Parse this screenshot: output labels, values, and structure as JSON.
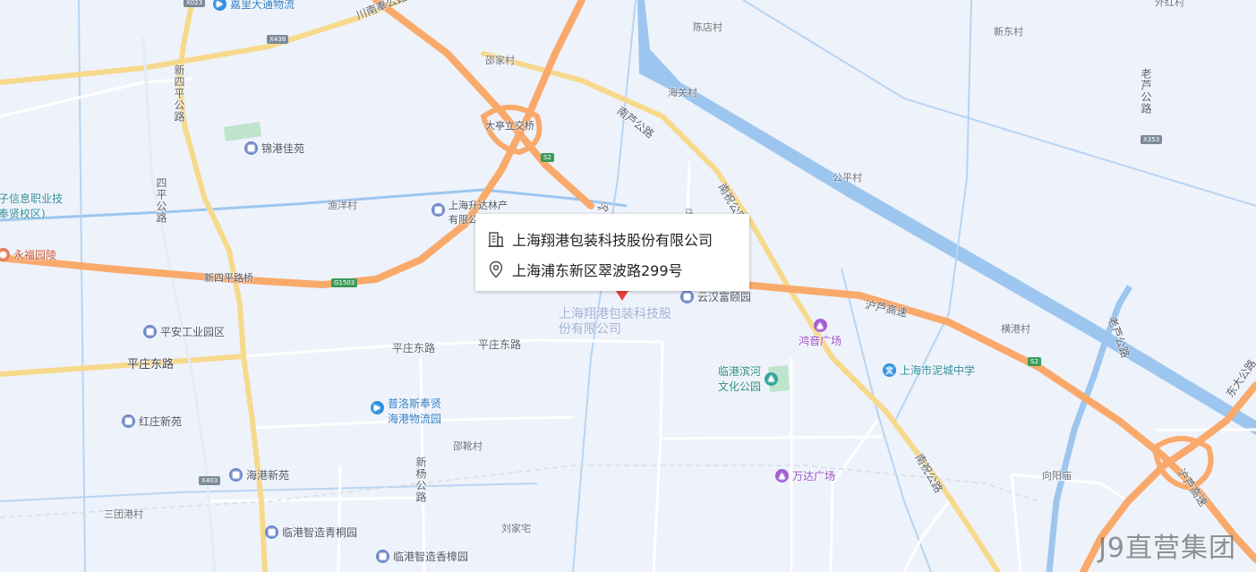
{
  "info_window": {
    "company_name": "上海翔港包装科技股份有限公司",
    "address": "上海浦东新区翠波路299号"
  },
  "marker": {
    "label": "上海翔港包装科技股份有限公司",
    "color": "#e8423b"
  },
  "watermark": "J9直营集团",
  "colors": {
    "background": "#eef2fa",
    "expressway": "#f9a96a",
    "major_road": "#f7d98c",
    "minor_road": "#ffffff",
    "water": "#9cc6ef",
    "green": "#bfe4cc"
  },
  "shields": {
    "x023": "X023",
    "x438": "X438",
    "s2_north": "S2",
    "g1503": "G1503",
    "x353": "X353",
    "s2_east": "S2",
    "x403": "X403"
  },
  "road_labels": {
    "chuannan": "川南奉公路",
    "xinsiping": "新四平公路",
    "siping": "四平公路",
    "nanlu": "南芦公路",
    "nanzhao_north": "南祝公路",
    "nanzhao_south": "南祝公路",
    "hulu_expressway": "沪芦高速",
    "hulu_expressway_se": "沪芦高速",
    "laolu_north": "老芦公路",
    "laolu_south": "老芦公路",
    "pingzhuang_west": "平庄东路",
    "pingzhuang_mid": "平庄东路",
    "pingzhuang_east": "平庄东路",
    "xinyang": "新杨公路",
    "dongda": "东大公路",
    "hu_vertical": "沪"
  },
  "place_labels": {
    "waihong": "外红村",
    "chendian": "陈店村",
    "shaojia": "邵家村",
    "xindong": "新东村",
    "haiguan": "海关村",
    "datingli": "大亭立交桥",
    "gongping": "公平村",
    "yuyang": "渔洋村",
    "xinsiping_bridge": "新四平路桥",
    "henggang": "横港村",
    "shaoxue": "邵靴村",
    "xiangyang": "向阳庙",
    "santuan": "三团港村",
    "liujia": "刘家宅",
    "ma": "马"
  },
  "pois": {
    "jiali": "嘉里大通物流",
    "jingang": "锦港佳苑",
    "xinxi_line1": "子信息职业技",
    "xinxi_line2": "奉贤校区)",
    "shengda_line1": "上海升达林产",
    "shengda_line2": "有限公",
    "yongfu": "永福园陵",
    "yunhan": "云汉富颐园",
    "hongyin": "鸿音广场",
    "pingan": "平安工业园区",
    "binhe_line1": "临港滨河",
    "binhe_line2": "文化公园",
    "nicheng_school": "上海市泥城中学",
    "puluosi_line1": "普洛斯奉贤",
    "puluosi_line2": "海港物流园",
    "hongzhuang": "红庄新苑",
    "haigang": "海港新苑",
    "wanda": "万达广场",
    "qingtong": "临港智造青桐园",
    "xiangzhang": "临港智造香樟园"
  }
}
